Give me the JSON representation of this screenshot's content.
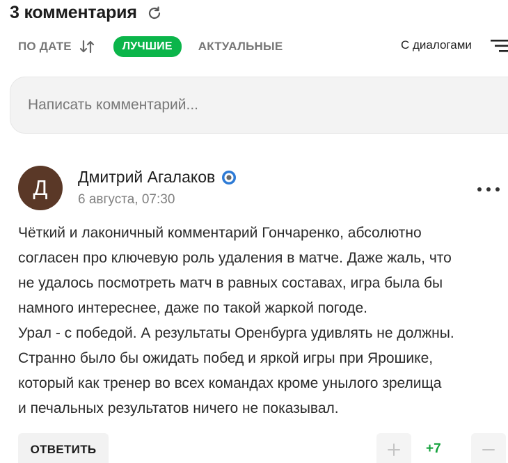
{
  "header": {
    "title": "3 комментария",
    "refresh_icon": "refresh-icon"
  },
  "sort": {
    "by_date": "ПО ДАТЕ",
    "best": "ЛУЧШИЕ",
    "actual": "АКТУАЛЬНЫЕ",
    "dialogs": "С диалогами",
    "accent_color": "#0bb54a"
  },
  "composer": {
    "placeholder": "Написать комментарий..."
  },
  "comment": {
    "avatar_letter": "Д",
    "avatar_color": "#5a3827",
    "author": "Дмитрий Агалаков",
    "date": "6 августа, 07:30",
    "lines": [
      "Чёткий и лаконичный комментарий Гончаренко, абсолютно",
      "согласен про ключевую роль удаления в матче. Даже жаль, что",
      "не удалось посмотреть матч в равных составах, игра была бы",
      "намного интереснее, даже по такой жаркой погоде.",
      "Урал - с победой. А результаты Оренбурга удивлять не должны.",
      "Странно было бы ожидать побед и яркой игры при Ярошике,",
      "который как тренер во всех командах кроме унылого зрелища",
      "и печальных результатов ничего не показывал."
    ],
    "reply_label": "ОТВЕТИТЬ",
    "score": "+7",
    "score_color": "#14a23c"
  }
}
